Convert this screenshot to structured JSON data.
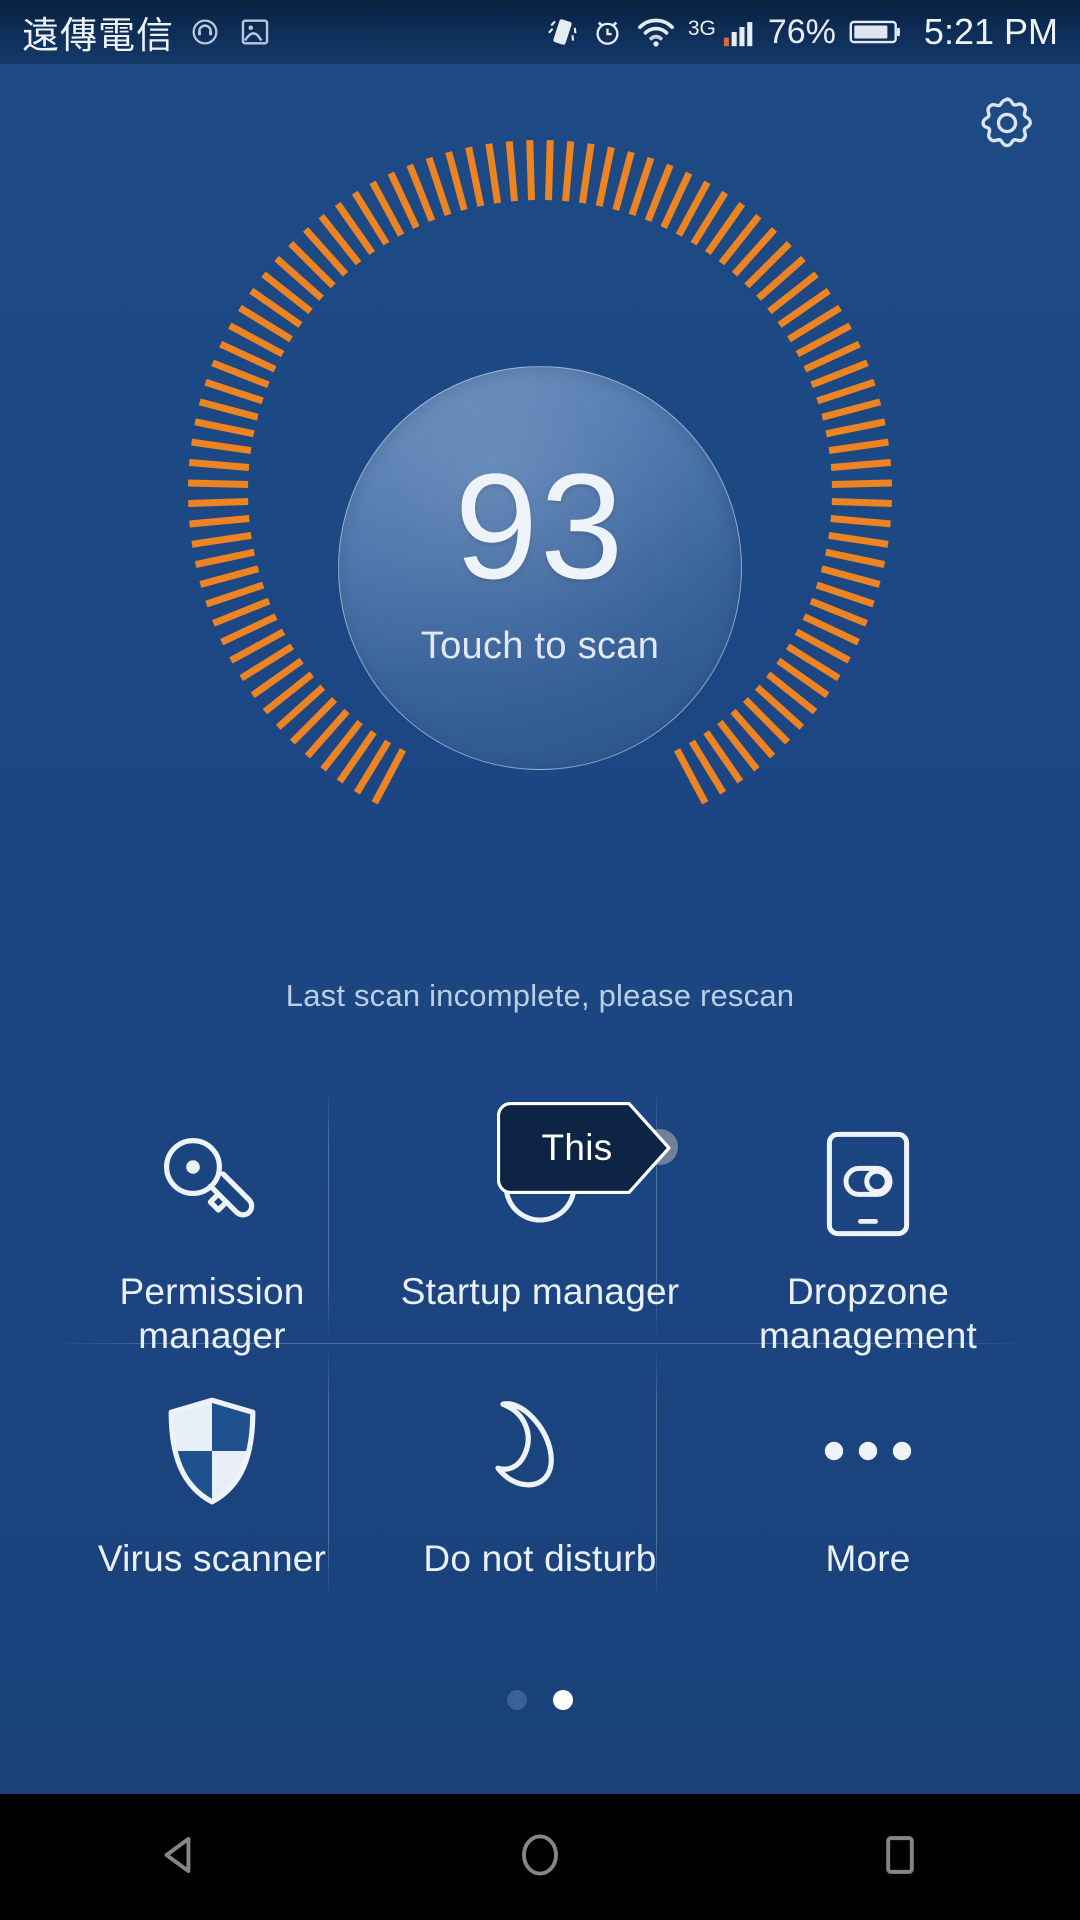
{
  "status_bar": {
    "carrier": "遠傳電信",
    "left_icons": [
      "headset-icon",
      "screenshot-image-icon"
    ],
    "right_icons": [
      "vibrate-icon",
      "alarm-clock-icon",
      "wifi-icon",
      "signal-bars-icon"
    ],
    "network_type": "3G",
    "battery_percent": "76%",
    "battery_icon": "battery-icon",
    "time": "5:21 PM"
  },
  "header": {
    "settings_icon": "gear-icon"
  },
  "scanner": {
    "score": "93",
    "action_label": "Touch to scan",
    "status_message": "Last scan incomplete, please rescan",
    "tick_color": "#ee8322",
    "tick_count": 92,
    "ticks_filled": 86,
    "circle_color": "#4a74ac"
  },
  "callout": {
    "label": "This",
    "fill": "#0e2444",
    "dot_color": "#7f8c9e"
  },
  "shortcuts": [
    {
      "icon": "key-icon",
      "label": "Permission\nmanager",
      "label_line1": "Permission",
      "label_line2": "manager"
    },
    {
      "icon": "power-restart-icon",
      "label": "Startup manager",
      "label_line1": "Startup manager",
      "label_line2": ""
    },
    {
      "icon": "phone-toggle-icon",
      "label": "Dropzone\nmanagement",
      "label_line1": "Dropzone",
      "label_line2": "management"
    },
    {
      "icon": "shield-icon",
      "label": "Virus scanner",
      "label_line1": "Virus scanner",
      "label_line2": ""
    },
    {
      "icon": "moon-icon",
      "label": "Do not disturb",
      "label_line1": "Do not disturb",
      "label_line2": ""
    },
    {
      "icon": "ellipsis-icon",
      "label": "More",
      "label_line1": "More",
      "label_line2": ""
    }
  ],
  "pagination": {
    "total": 2,
    "active_index": 1
  },
  "navbar": {
    "back_icon": "back-triangle-icon",
    "home_icon": "home-circle-icon",
    "recents_icon": "recents-square-icon"
  },
  "theme": {
    "background": "#1c4784",
    "accent_orange": "#ee8322",
    "text_primary": "#eaf0f8",
    "text_secondary": "#bdcde4"
  }
}
